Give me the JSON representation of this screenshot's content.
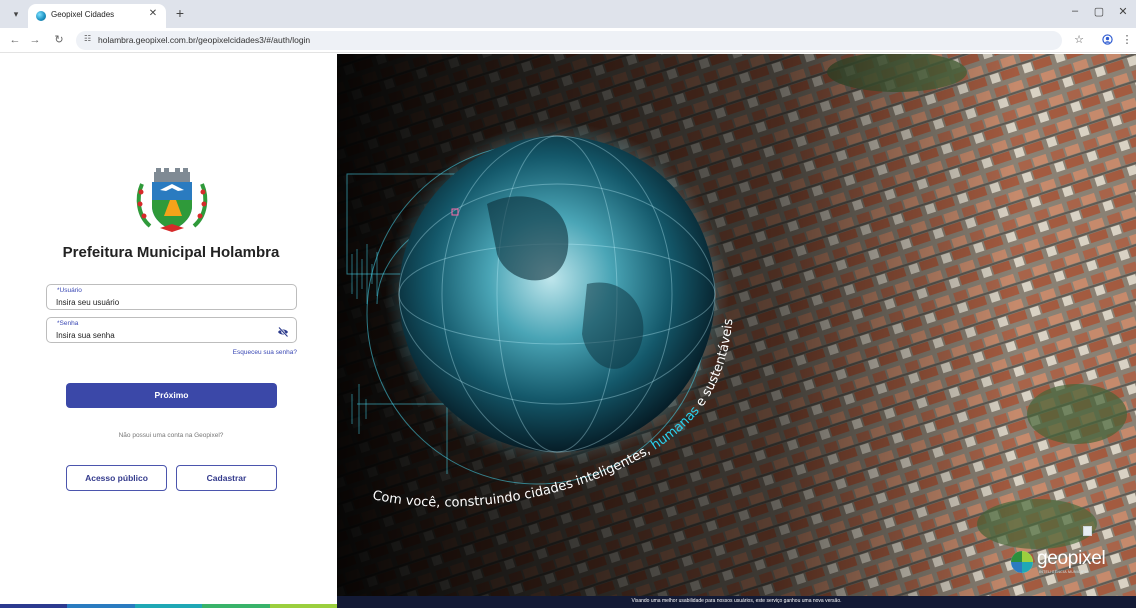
{
  "browser": {
    "tab_title": "Geopixel Cidades",
    "url": "holambra.geopixel.com.br/geopixelcidades3/#/auth/login"
  },
  "login": {
    "org_title": "Prefeitura Municipal Holambra",
    "username_label": "*Usuário",
    "username_placeholder": "Insira seu usuário",
    "password_label": "*Senha",
    "password_placeholder": "Insira sua senha",
    "forgot_link": "Esqueceu sua senha?",
    "next_button": "Próximo",
    "no_account_text": "Não possui uma conta na Geopixel?",
    "public_access_button": "Acesso público",
    "register_button": "Cadastrar"
  },
  "hero": {
    "slogan_part1": "Com você, construindo cidades inteligentes, ",
    "slogan_part2": "humanas",
    "slogan_part3": " e sustentáveis",
    "brand_name": "geopixel",
    "brand_tagline": "INTELIGÊNCIA MUNICIPAL",
    "bottom_notice": "Visando uma melhor usabilidade para nossos usuários, este serviço ganhou uma nova versão."
  },
  "colors": {
    "primary": "#3b48a8",
    "link": "#3a48b4",
    "notice_bar": "#131a35"
  },
  "icons": {
    "password_toggle": "eye-off-icon",
    "site_info": "tune-icon"
  }
}
